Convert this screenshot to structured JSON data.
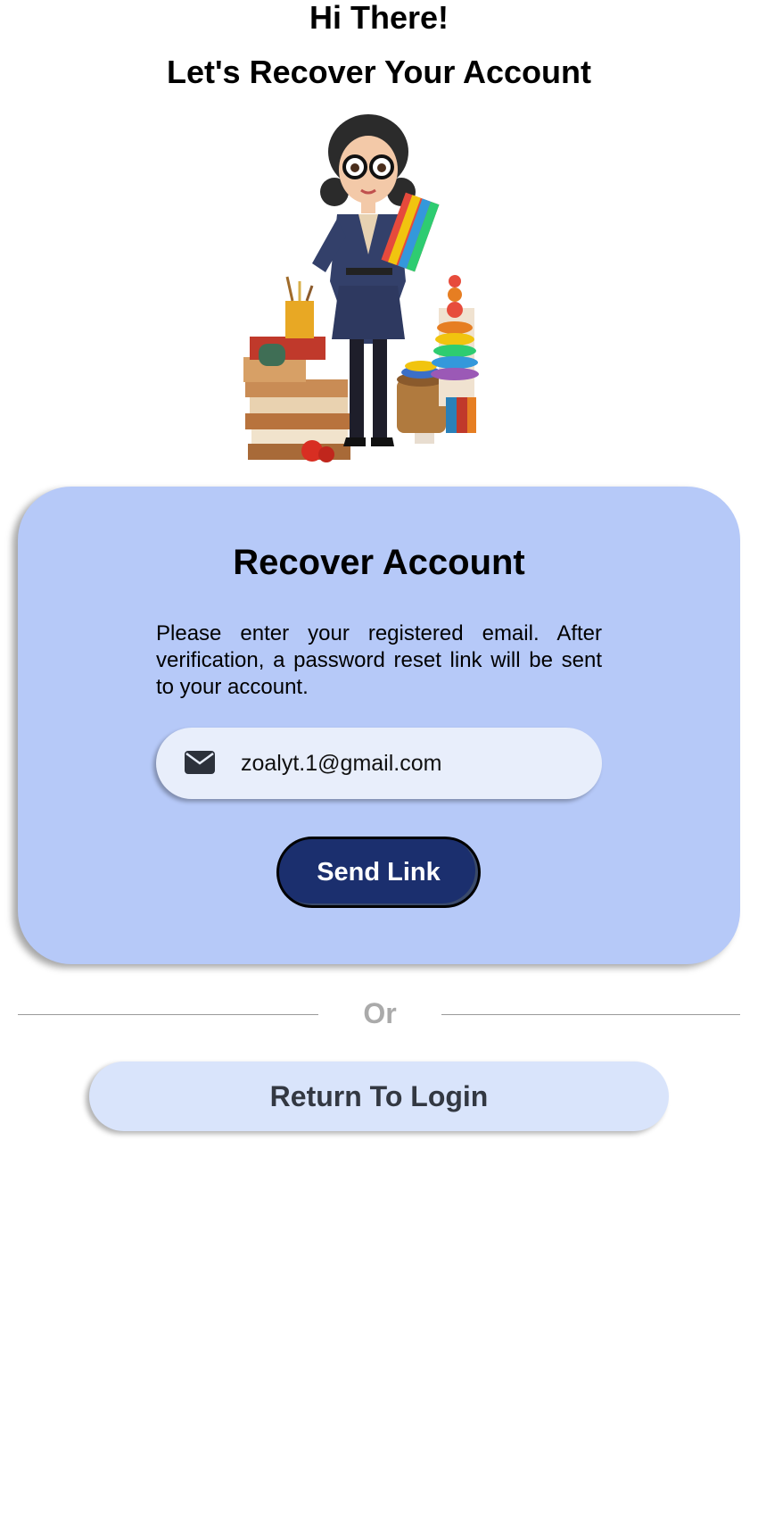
{
  "header": {
    "greeting": "Hi There!",
    "subtitle": "Let's Recover Your Account"
  },
  "illustration": {
    "icon": "teacher-illustration"
  },
  "card": {
    "title": "Recover Account",
    "description": "Please enter your registered email. After verification, a password reset link will be sent to your account.",
    "email": {
      "icon": "envelope-icon",
      "value": "zoalyt.1@gmail.com",
      "placeholder": ""
    },
    "send_button": "Send Link",
    "background_color": "#b6c9f8",
    "button_color": "#1b2f6e"
  },
  "divider": {
    "label": "Or"
  },
  "footer": {
    "return_button": "Return To Login"
  }
}
